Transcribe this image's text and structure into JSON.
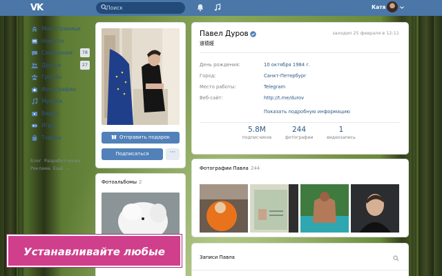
{
  "header": {
    "logo": "VK",
    "search_placeholder": "Поиск",
    "user_name": "Катя",
    "icons": [
      "bell-icon",
      "music-note-icon"
    ]
  },
  "sidebar": {
    "items": [
      {
        "label": "Моя Страница",
        "icon": "home-icon"
      },
      {
        "label": "Новости",
        "icon": "news-icon"
      },
      {
        "label": "Сообщения",
        "icon": "chat-icon",
        "count": "78"
      },
      {
        "label": "Друзья",
        "icon": "friends-icon",
        "count": "27"
      },
      {
        "label": "Группы",
        "icon": "groups-icon"
      },
      {
        "label": "Фотографии",
        "icon": "camera-icon"
      },
      {
        "label": "Музыка",
        "icon": "music-icon"
      },
      {
        "label": "Видео",
        "icon": "video-icon"
      },
      {
        "label": "Игры",
        "icon": "games-icon"
      },
      {
        "label": "Товары",
        "icon": "bag-icon"
      }
    ],
    "footer": [
      "Блог",
      "Разработчикам",
      "Реклама",
      "Ещё"
    ]
  },
  "profile_card": {
    "gift_button": "Отправить подарок",
    "subscribe_button": "Подписаться",
    "more_button": "···"
  },
  "albums": {
    "title": "Фотоальбомы",
    "count": "2"
  },
  "info": {
    "name": "Павел Дуров",
    "status": "道德經",
    "last_seen": "заходил 25 февраля в 12:11",
    "rows": [
      {
        "key": "День рождения:",
        "value": "10 октября 1984 г."
      },
      {
        "key": "Город:",
        "value": "Санкт-Петербург"
      },
      {
        "key": "Место работы:",
        "value": "Telegram"
      },
      {
        "key": "Веб-сайт:",
        "value": "http://t.me/durov"
      }
    ],
    "show_more": "Показать подробную информацию",
    "stats": [
      {
        "n": "5.8M",
        "l": "подписчиков"
      },
      {
        "n": "244",
        "l": "фотографии"
      },
      {
        "n": "1",
        "l": "видеозапись"
      }
    ]
  },
  "photos": {
    "title": "Фотографии Павла",
    "count": "244"
  },
  "wall": {
    "title": "Записи Павла"
  },
  "promo": {
    "text": "Устанавливайте любые обои"
  },
  "colors": {
    "header": "#4a76a8",
    "button": "#5181b8",
    "link": "#2a5885",
    "promo": "#cf3f8c"
  }
}
